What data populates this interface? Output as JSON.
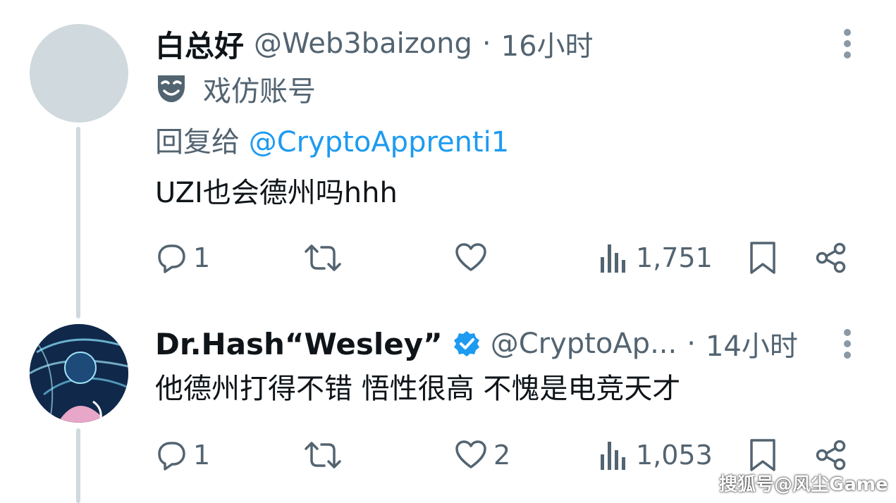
{
  "tweets": [
    {
      "display_name": "白总好",
      "handle": "@Web3baizong",
      "separator": "·",
      "time": "16小时",
      "parody_label": "戏仿账号",
      "reply_prefix": "回复给",
      "reply_to": "@CryptoApprenti1",
      "text": "UZI也会德州吗hhh",
      "stats": {
        "replies": "1",
        "reposts": "",
        "likes": "",
        "views": "1,751"
      }
    },
    {
      "display_name": "Dr.Hash“Wesley”",
      "verified": true,
      "handle": "@CryptoAp...",
      "separator": "·",
      "time": "14小时",
      "text": "他德州打得不错 悟性很高 不愧是电竞天才",
      "stats": {
        "replies": "1",
        "reposts": "",
        "likes": "2",
        "views": "1,053"
      }
    }
  ],
  "watermark": "搜狐号@风尘Game",
  "colors": {
    "text": "#0f1419",
    "secondary": "#536471",
    "accent": "#1d9bf0",
    "thread_line": "#cfd9de"
  },
  "icons": [
    "more-icon",
    "parody-mask-icon",
    "reply-icon",
    "repost-icon",
    "like-icon",
    "views-icon",
    "bookmark-icon",
    "share-icon",
    "verified-icon"
  ]
}
